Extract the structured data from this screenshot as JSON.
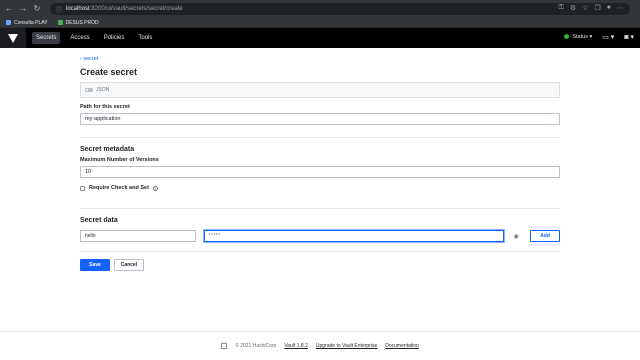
{
  "browser": {
    "url_host": "localhost",
    "url_path": ":8200/ui/vault/secrets/secret/create",
    "bookmarks": [
      {
        "label": "Consulta PLAY"
      },
      {
        "label": "DESUS PROD"
      }
    ]
  },
  "header": {
    "nav": [
      {
        "label": "Secrets"
      },
      {
        "label": "Access"
      },
      {
        "label": "Policies"
      },
      {
        "label": "Tools"
      }
    ],
    "status_label": "Status"
  },
  "main": {
    "breadcrumb": "secret",
    "title": "Create secret",
    "json_toggle_label": "JSON",
    "path_label": "Path for this secret",
    "path_value": "my-application",
    "metadata_title": "Secret metadata",
    "max_versions_label": "Maximum Number of Versions",
    "max_versions_value": "10",
    "cas_label": "Require Check and Set"
  },
  "secret_data": {
    "title": "Secret data",
    "key_value": "hello",
    "value_masked": "*****",
    "add_label": "Add",
    "save_label": "Save",
    "cancel_label": "Cancel"
  },
  "footer": {
    "copyright": "© 2021 HashiCorp",
    "version": "Vault 1.8.2",
    "upgrade": "Upgrade to Vault Enterprise",
    "docs": "Documentation"
  },
  "colors": {
    "accent": "#1563ff",
    "header_bg": "#000000",
    "status_ok": "#2eb039"
  }
}
